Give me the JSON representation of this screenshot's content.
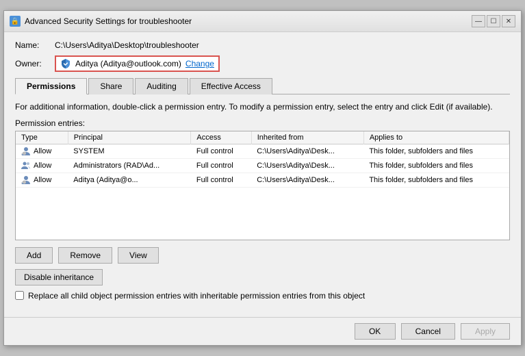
{
  "window": {
    "title": "Advanced Security Settings for troubleshooter",
    "icon": "🔒"
  },
  "title_controls": {
    "minimize": "—",
    "maximize": "☐",
    "close": "✕"
  },
  "fields": {
    "name_label": "Name:",
    "name_value": "C:\\Users\\Aditya\\Desktop\\troubleshooter",
    "owner_label": "Owner:",
    "owner_value": "Aditya (Aditya@outlook.com)",
    "change_label": "Change"
  },
  "tabs": [
    {
      "id": "permissions",
      "label": "Permissions",
      "active": true
    },
    {
      "id": "share",
      "label": "Share",
      "active": false
    },
    {
      "id": "auditing",
      "label": "Auditing",
      "active": false
    },
    {
      "id": "effective-access",
      "label": "Effective Access",
      "active": false
    }
  ],
  "info_text": "For additional information, double-click a permission entry. To modify a permission entry, select the entry and click Edit (if available).",
  "section_label": "Permission entries:",
  "table": {
    "columns": [
      "Type",
      "Principal",
      "Access",
      "Inherited from",
      "Applies to"
    ],
    "rows": [
      {
        "type": "Allow",
        "principal": "SYSTEM",
        "access": "Full control",
        "inherited_from": "C:\\Users\\Aditya\\Desk...",
        "applies_to": "This folder, subfolders and files",
        "icon": "user"
      },
      {
        "type": "Allow",
        "principal": "Administrators (RAD\\Ad...",
        "access": "Full control",
        "inherited_from": "C:\\Users\\Aditya\\Desk...",
        "applies_to": "This folder, subfolders and files",
        "icon": "users"
      },
      {
        "type": "Allow",
        "principal": "Aditya (Aditya@o...",
        "access": "Full control",
        "inherited_from": "C:\\Users\\Aditya\\Desk...",
        "applies_to": "This folder, subfolders and files",
        "icon": "user"
      }
    ]
  },
  "buttons": {
    "add": "Add",
    "remove": "Remove",
    "view": "View",
    "disable_inheritance": "Disable inheritance"
  },
  "checkbox": {
    "label": "Replace all child object permission entries with inheritable permission entries from this object"
  },
  "footer": {
    "ok": "OK",
    "cancel": "Cancel",
    "apply": "Apply"
  }
}
